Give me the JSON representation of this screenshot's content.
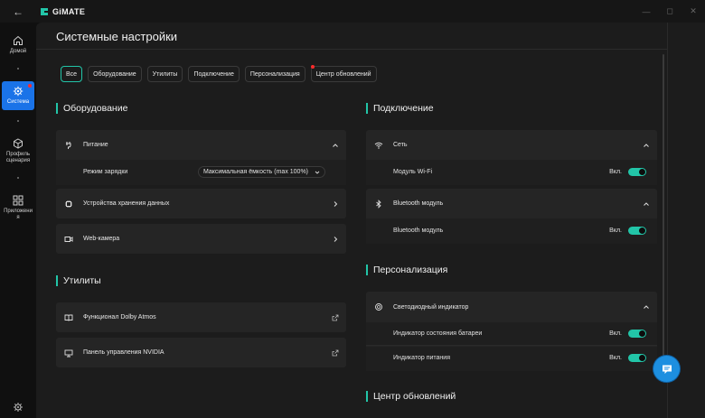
{
  "app": {
    "brand_name": "GiMATE",
    "back_glyph": "←",
    "window_controls": [
      "—",
      "◻",
      "✕"
    ]
  },
  "nav": {
    "items": [
      {
        "label": "Домой",
        "icon": "home-icon",
        "active": false
      },
      {
        "label": "Система",
        "icon": "gear-icon",
        "active": true,
        "badge": true
      },
      {
        "label": "Профиль сценария",
        "icon": "cube-icon",
        "active": false
      },
      {
        "label": "Приложения",
        "icon": "apps-icon",
        "active": false
      }
    ],
    "bottom_icon": "settings-icon"
  },
  "page": {
    "title": "Системные настройки"
  },
  "filters": [
    {
      "label": "Все",
      "active": true,
      "badge": false
    },
    {
      "label": "Оборудование",
      "active": false,
      "badge": false
    },
    {
      "label": "Утилиты",
      "active": false,
      "badge": false
    },
    {
      "label": "Подключение",
      "active": false,
      "badge": false
    },
    {
      "label": "Персонализация",
      "active": false,
      "badge": false
    },
    {
      "label": "Центр обновлений",
      "active": false,
      "badge": true
    }
  ],
  "hardware": {
    "title": "Оборудование",
    "power": {
      "label": "Питание",
      "charge_mode_label": "Режим зарядки",
      "charge_mode_value": "Максимальная ёмкость (max 100%)"
    },
    "storage_label": "Устройства хранения данных",
    "webcam_label": "Web-камера"
  },
  "utilities": {
    "title": "Утилиты",
    "dolby_label": "Функционал Dolby Atmos",
    "nvidia_label": "Панель управления NVIDIA"
  },
  "connection": {
    "title": "Подключение",
    "network": {
      "label": "Сеть",
      "wifi_label": "Модуль Wi-Fi",
      "wifi_state": "Вкл.",
      "wifi_on": true
    },
    "bluetooth": {
      "label": "Bluetooth модуль",
      "module_label": "Bluetooth модуль",
      "module_state": "Вкл.",
      "module_on": true
    }
  },
  "personalization": {
    "title": "Персонализация",
    "led": {
      "label": "Светодиодный индикатор",
      "battery_label": "Индикатор состояния батареи",
      "battery_state": "Вкл.",
      "battery_on": true,
      "power_label": "Индикатор питания",
      "power_state": "Вкл.",
      "power_on": true
    }
  },
  "updates": {
    "title": "Центр обновлений"
  },
  "colors": {
    "accent": "#22c5a8",
    "nav_active": "#1a73e8",
    "badge": "#ff2b2b",
    "chat_fab": "#1d8fe0"
  }
}
